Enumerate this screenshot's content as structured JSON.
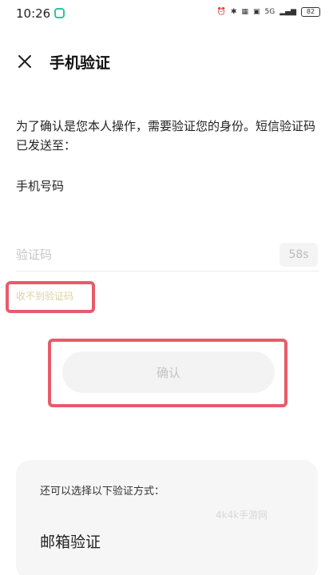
{
  "status": {
    "time": "10:26",
    "network": "5G",
    "battery": "82"
  },
  "header": {
    "title": "手机验证"
  },
  "description": "为了确认是您本人操作，需要验证您的身份。短信验证码已发送至：",
  "phone_label": "手机号码",
  "code_field": {
    "placeholder": "验证码",
    "countdown": "58s"
  },
  "resend_label": "收不到验证码",
  "confirm_label": "确认",
  "alternatives": {
    "title": "还可以选择以下验证方式：",
    "email_label": "邮箱验证",
    "watermark": "4k4k手游网"
  },
  "colors": {
    "highlight": "#e85b6a",
    "app_icon": "#2ec4a0",
    "resend_text": "#d9d3a0"
  }
}
